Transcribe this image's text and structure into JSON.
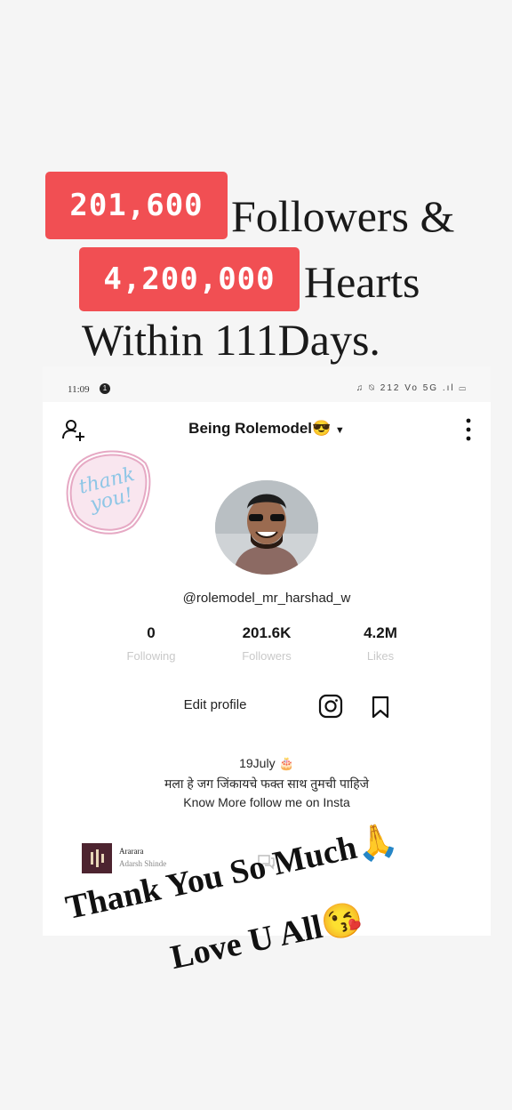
{
  "overlay": {
    "followers_count": "201,600",
    "followers_text": "Followers &",
    "hearts_count": "4,200,000",
    "hearts_text": "Hearts",
    "within_text": "Within 111Days.",
    "thanks_line1": "Thank You So Much🙏",
    "thanks_line2": "Love U All😘"
  },
  "colors": {
    "badge": "#f14f53",
    "page_bg": "#f5f5f5"
  },
  "statusbar": {
    "time": "11:09",
    "notification_count": "1",
    "indicators": "♫ ⍉ 212 Vo 5G .ıl ▭"
  },
  "profile": {
    "account_name": "Being Rolemodel😎",
    "handle": "@rolemodel_mr_harshad_w",
    "sticker_text": "thank you!",
    "stats": [
      {
        "value": "0",
        "label": "Following"
      },
      {
        "value": "201.6K",
        "label": "Followers"
      },
      {
        "value": "4.2M",
        "label": "Likes"
      }
    ],
    "edit_profile": "Edit profile",
    "bio_line1": "19July 🎂",
    "bio_line2": "मला हे जग जिंकायचे फक्त साथ तुमची पाहिजे",
    "bio_line3": "Know More follow me on Insta"
  },
  "music": {
    "title": "Ararara",
    "artist": "Adarsh Shinde"
  },
  "icons": [
    "add-user-icon",
    "chevron-down-icon",
    "more-vertical-icon",
    "instagram-icon",
    "bookmark-icon",
    "chat-icon"
  ]
}
